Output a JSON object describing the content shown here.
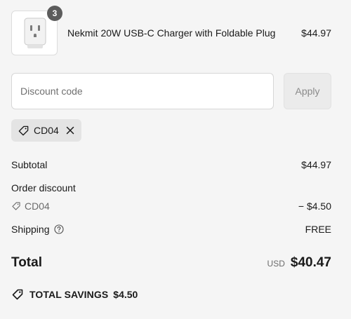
{
  "product": {
    "image_icon": "usb-c-charger-image",
    "quantity": "3",
    "name": "Nekmit 20W USB-C Charger with Foldable Plug",
    "price": "$44.97"
  },
  "discount": {
    "placeholder": "Discount code",
    "value": "",
    "apply_label": "Apply",
    "applied_code": "CD04"
  },
  "summary": {
    "subtotal_label": "Subtotal",
    "subtotal_value": "$44.97",
    "order_discount_label": "Order discount",
    "discount_code": "CD04",
    "discount_value": "− $4.50",
    "shipping_label": "Shipping",
    "shipping_value": "FREE",
    "total_label": "Total",
    "currency": "USD",
    "total_value": "$40.47",
    "savings_label": "TOTAL SAVINGS",
    "savings_value": "$4.50"
  },
  "colors": {
    "background": "#f5f5f5",
    "badge": "#5c5c5c",
    "chip": "#e4e4e4",
    "muted_text": "#6b6b6b"
  }
}
